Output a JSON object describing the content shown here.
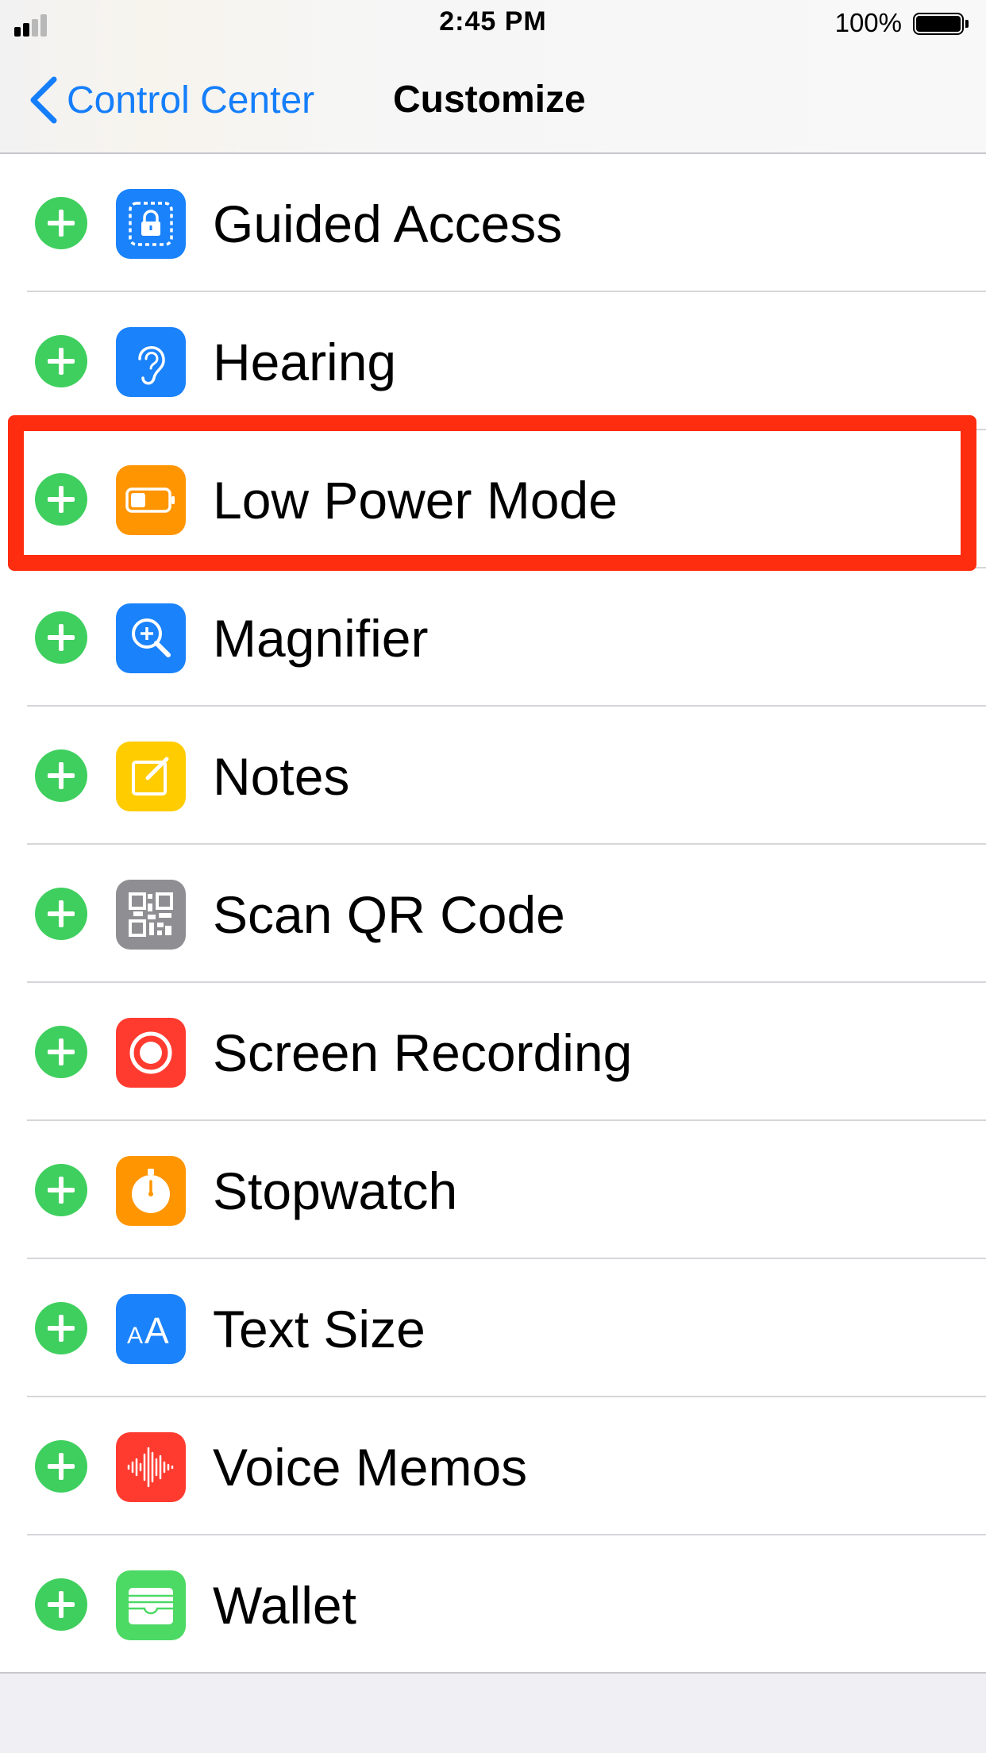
{
  "status_bar": {
    "time": "2:45 PM",
    "battery_percent": "100%",
    "signal_bars_total": 4,
    "signal_bars_active": 2
  },
  "nav": {
    "back_label": "Control Center",
    "title": "Customize"
  },
  "colors": {
    "accent": "#157efb",
    "add_button": "#3fcf5e",
    "highlight": "#ff2d10"
  },
  "items": [
    {
      "label": "Guided Access",
      "icon": "guided-access-icon",
      "icon_color": "#1a82fb"
    },
    {
      "label": "Hearing",
      "icon": "ear-icon",
      "icon_color": "#1a82fb"
    },
    {
      "label": "Low Power Mode",
      "icon": "low-battery-icon",
      "icon_color": "#ff9500"
    },
    {
      "label": "Magnifier",
      "icon": "magnifier-icon",
      "icon_color": "#1a82fb"
    },
    {
      "label": "Notes",
      "icon": "notes-icon",
      "icon_color": "#ffcc00"
    },
    {
      "label": "Scan QR Code",
      "icon": "qr-code-icon",
      "icon_color": "#8e8e93"
    },
    {
      "label": "Screen Recording",
      "icon": "screen-recording-icon",
      "icon_color": "#ff3b30"
    },
    {
      "label": "Stopwatch",
      "icon": "stopwatch-icon",
      "icon_color": "#ff9500"
    },
    {
      "label": "Text Size",
      "icon": "text-size-icon",
      "icon_color": "#1a82fb"
    },
    {
      "label": "Voice Memos",
      "icon": "voice-memos-icon",
      "icon_color": "#ff3b30"
    },
    {
      "label": "Wallet",
      "icon": "wallet-icon",
      "icon_color": "#4cd964"
    }
  ],
  "highlighted_item": "Low Power Mode"
}
